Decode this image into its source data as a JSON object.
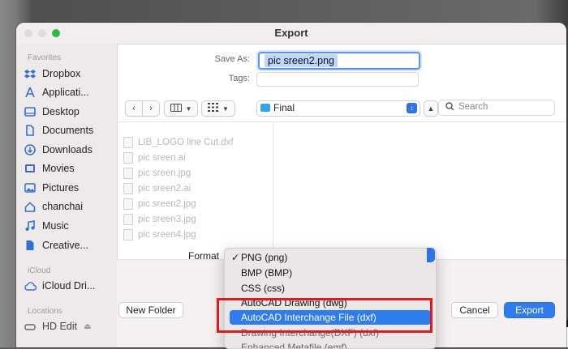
{
  "window": {
    "title": "Export"
  },
  "sidebar": {
    "favorites_label": "Favorites",
    "favorites": [
      {
        "label": "Dropbox",
        "icon": "dropbox-icon"
      },
      {
        "label": "Applicati...",
        "icon": "applications-icon"
      },
      {
        "label": "Desktop",
        "icon": "desktop-icon"
      },
      {
        "label": "Documents",
        "icon": "document-icon"
      },
      {
        "label": "Downloads",
        "icon": "download-icon"
      },
      {
        "label": "Movies",
        "icon": "movies-icon"
      },
      {
        "label": "Pictures",
        "icon": "pictures-icon"
      },
      {
        "label": "chanchai",
        "icon": "home-icon"
      },
      {
        "label": "Music",
        "icon": "music-icon"
      },
      {
        "label": "Creative...",
        "icon": "file-icon"
      }
    ],
    "icloud_label": "iCloud",
    "icloud": [
      {
        "label": "iCloud Dri...",
        "icon": "cloud-icon"
      }
    ],
    "locations_label": "Locations",
    "locations": [
      {
        "label": "HD Edit",
        "icon": "disk-icon"
      }
    ]
  },
  "fields": {
    "save_as_label": "Save As:",
    "save_as_value": "pic sreen2.png",
    "tags_label": "Tags:"
  },
  "toolbar": {
    "location": "Final",
    "search_placeholder": "Search"
  },
  "files": [
    "LIB_LOGO line Cut.dxf",
    "pic sreen.ai",
    "pic sreen.jpg",
    "pic sreen2.ai",
    "pic sreen2.jpg",
    "pic sreen3.jpg",
    "pic sreen4.jpg"
  ],
  "format": {
    "label": "Format",
    "options": [
      {
        "label": "PNG (png)",
        "checked": true
      },
      {
        "label": "BMP (BMP)",
        "checked": false
      },
      {
        "label": "CSS (css)",
        "checked": false
      },
      {
        "label": "AutoCAD Drawing (dwg)",
        "checked": false
      },
      {
        "label": "AutoCAD Interchange File (dxf)",
        "checked": false,
        "highlighted": true
      },
      {
        "label": "Drawing Interchange(DXF) (dxf)",
        "checked": false
      },
      {
        "label": "Enhanced Metafile (emf)",
        "checked": false
      }
    ]
  },
  "buttons": {
    "new_folder": "New Folder",
    "cancel": "Cancel",
    "export": "Export"
  },
  "colors": {
    "accent": "#2f7bf0",
    "highlight_box": "#e31a1a"
  }
}
